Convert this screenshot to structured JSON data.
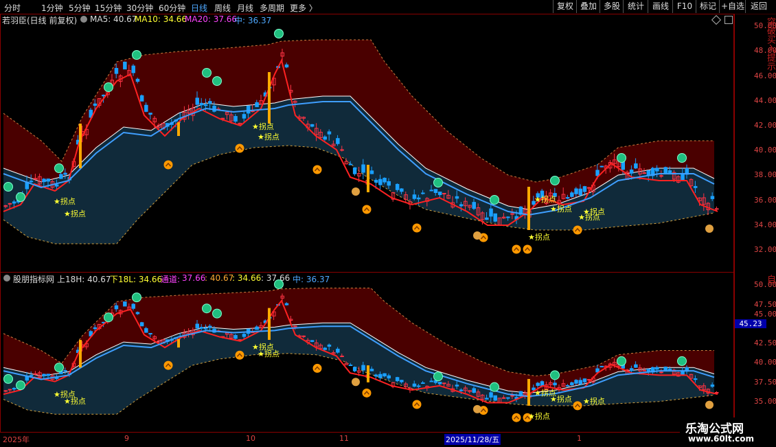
{
  "toolbar": {
    "timeframes": [
      "分时",
      "1分钟",
      "5分钟",
      "15分钟",
      "30分钟",
      "60分钟",
      "日线",
      "周线",
      "月线",
      "多周期",
      "更多 〉"
    ],
    "active": "日线",
    "right_buttons": [
      "复权",
      "叠加",
      "多股",
      "统计",
      "画线",
      "F10",
      "标记",
      "+自选",
      "返回"
    ]
  },
  "upper_panel": {
    "stock_label": "若羽臣(日线 前复权)",
    "ma5": "MA5: 40.67",
    "ma10": "MA10: 34.66",
    "ma20": "MA20: 37.66",
    "mid": "中: 36.37",
    "y_ticks": [
      "50.00",
      "48.00",
      "46.00",
      "44.00",
      "42.00",
      "40.00",
      "38.00",
      "36.00",
      "34.00",
      "32.00"
    ],
    "side_text": "突破买入提示"
  },
  "lower_panel": {
    "indicator_label": "股朋指标网",
    "upper": "上18H: 40.67",
    "lower": "下18L: 34.66",
    "channel_label": "通道:",
    "channel_values": [
      "37.66",
      ": 40.67",
      ": 34.66",
      ": 37.66"
    ],
    "mid": "中: 36.37",
    "y_ticks": [
      "50.00",
      "47.50",
      "45.00",
      "42.50",
      "40.00",
      "37.50",
      "35.00"
    ],
    "price_box": "45.23",
    "side_text": "自"
  },
  "annotation_text": "★拐点",
  "date_axis": [
    "2025年",
    "9",
    "10",
    "11",
    "2025/11/28/五",
    "1"
  ],
  "watermark": {
    "title": "乐淘公式网",
    "url": "www.60lt.com"
  },
  "colors": {
    "up": "#ff3344",
    "down": "#1aa0ff",
    "band_upper": "#4a0000",
    "band_lower": "#102a3a",
    "accent_blue": "#4ea8ff"
  }
}
